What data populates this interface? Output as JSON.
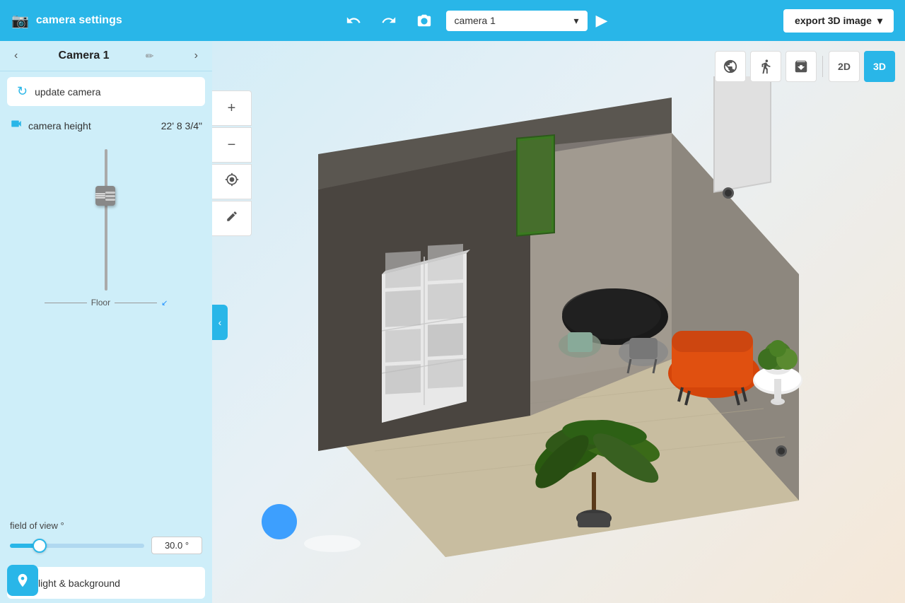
{
  "topbar": {
    "app_icon": "📷",
    "app_title": "camera settings",
    "undo_label": "undo",
    "redo_label": "redo",
    "screenshot_icon": "📷",
    "camera_dropdown_value": "camera 1",
    "play_label": "▶",
    "export_label": "export 3D image",
    "export_chevron": "▾"
  },
  "panel": {
    "title": "Camera 1",
    "nav_prev": "‹",
    "nav_next": "›",
    "edit_icon": "✏",
    "update_camera_label": "update camera",
    "camera_height_label": "camera height",
    "camera_height_value": "22' 8 3/4\"",
    "floor_label": "Floor",
    "field_of_view_label": "field of view °",
    "fov_value": "30.0 °",
    "fov_slider_percent": 22,
    "light_bg_label": "light & background"
  },
  "viewport_toolbar": {
    "orbit_icon": "⊕",
    "person_icon": "🚶",
    "cube_icon": "⊡",
    "label_2d": "2D",
    "label_3d": "3D"
  },
  "left_toolbar": {
    "plus_label": "+",
    "minus_label": "−",
    "target_label": "⊙",
    "pencil_label": "✎"
  }
}
